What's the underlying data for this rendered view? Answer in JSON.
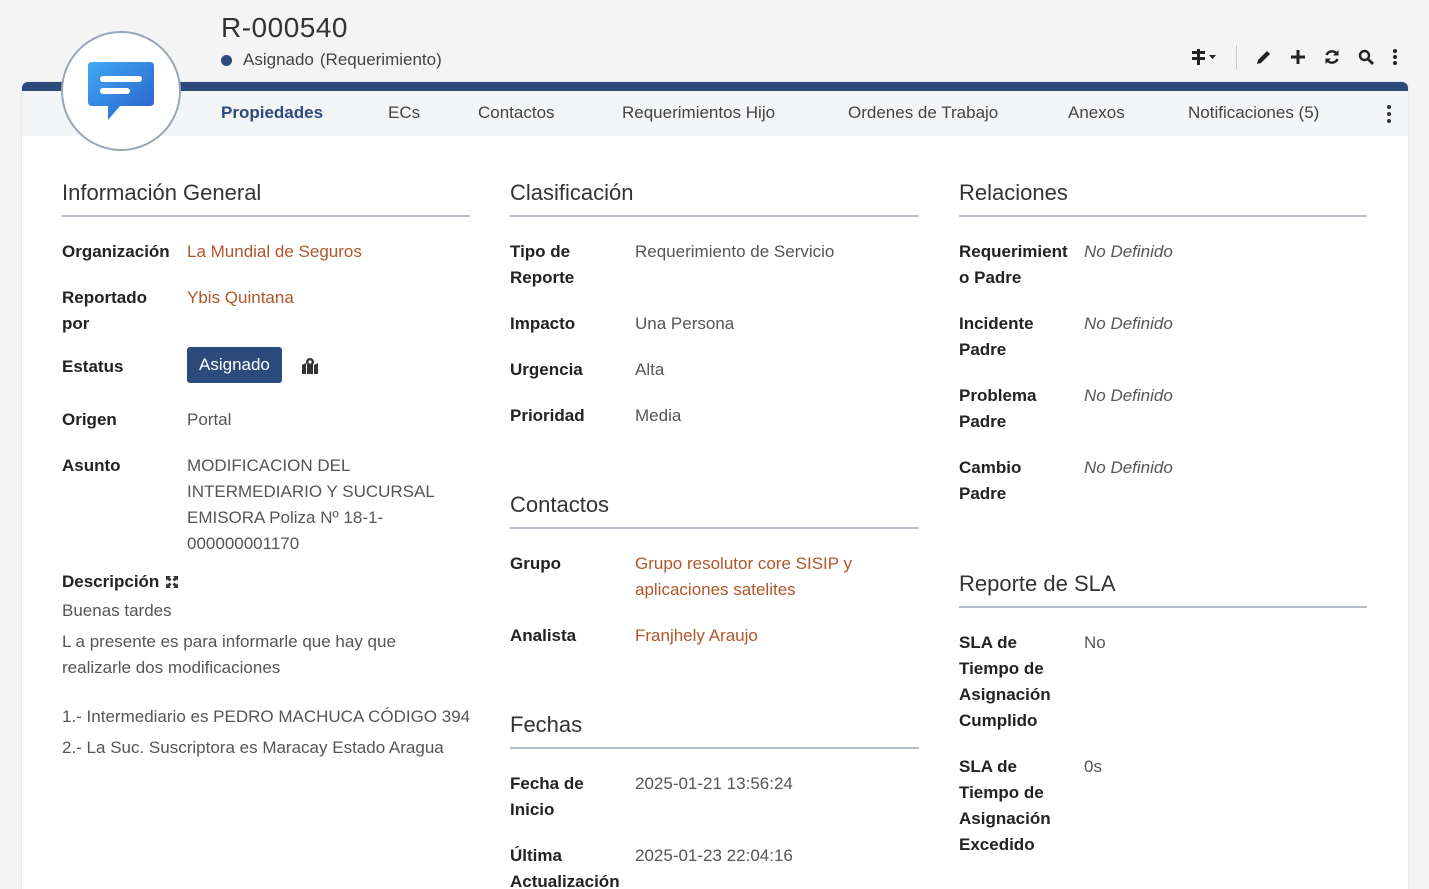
{
  "header": {
    "title": "R-000540",
    "status": "Asignado",
    "type": "(Requerimiento)"
  },
  "tabs": [
    "Propiedades",
    "ECs",
    "Contactos",
    "Requerimientos Hijo",
    "Ordenes de Trabajo",
    "Anexos",
    "Notificaciones (5)"
  ],
  "general": {
    "title": "Información General",
    "org_label": "Organización",
    "org_value": "La Mundial de Seguros",
    "rep_label": "Reportado por",
    "rep_value": "Ybis Quintana",
    "status_label": "Estatus",
    "status_value": "Asignado",
    "origin_label": "Origen",
    "origin_value": "Portal",
    "subject_label": "Asunto",
    "subject_value": "MODIFICACION DEL INTERMEDIARIO Y SUCURSAL EMISORA Poliza Nº 18-1-000000001170",
    "desc_label": "Descripción",
    "desc_p1": "Buenas tardes",
    "desc_p2": "L a presente es para informarle que hay que realizarle dos modificaciones",
    "desc_p3": "1.- Intermediario es PEDRO MACHUCA  CÓDIGO 394",
    "desc_p4": "2.- La Suc. Suscriptora es Maracay Estado Aragua"
  },
  "classification": {
    "title": "Clasificación",
    "type_label": "Tipo de Reporte",
    "type_value": "Requerimiento de Servicio",
    "impact_label": "Impacto",
    "impact_value": "Una Persona",
    "urgency_label": "Urgencia",
    "urgency_value": "Alta",
    "priority_label": "Prioridad",
    "priority_value": "Media"
  },
  "contacts": {
    "title": "Contactos",
    "group_label": "Grupo",
    "group_value": "Grupo resolutor core SISIP y aplicaciones satelites",
    "analyst_label": "Analista",
    "analyst_value": "Franjhely Araujo"
  },
  "dates": {
    "title": "Fechas",
    "start_label": "Fecha de Inicio",
    "start_value": "2025-01-21 13:56:24",
    "update_label": "Última Actualización",
    "update_value": "2025-01-23 22:04:16"
  },
  "relations": {
    "title": "Relaciones",
    "req_label": "Requerimient o Padre",
    "req_value": "No Definido",
    "inc_label": "Incidente Padre",
    "inc_value": "No Definido",
    "prob_label": "Problema Padre",
    "prob_value": "No Definido",
    "change_label": "Cambio Padre",
    "change_value": "No Definido"
  },
  "sla": {
    "title": "Reporte de SLA",
    "met_label": "SLA de Tiempo de Asignación Cumplido",
    "met_value": "No",
    "exceeded_label": "SLA de Tiempo de Asignación Excedido",
    "exceeded_value": "0s"
  },
  "colors": {
    "primary": "#2c4a7c",
    "link": "#b0562a"
  }
}
